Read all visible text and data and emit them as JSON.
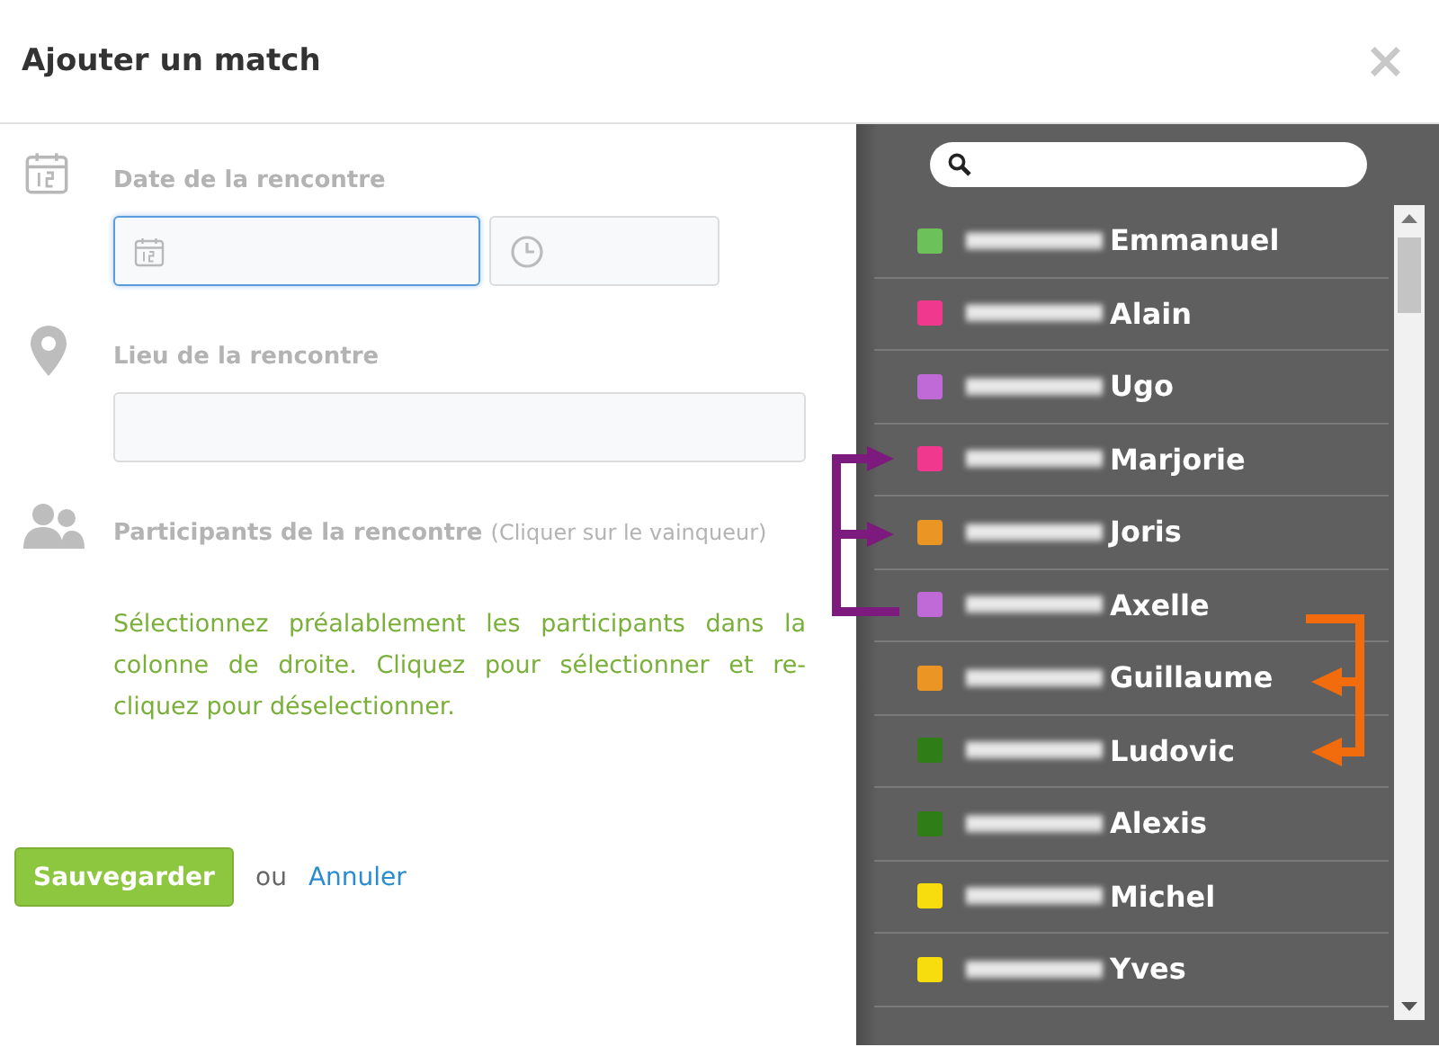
{
  "dialog": {
    "title": "Ajouter un match",
    "close": "×"
  },
  "form": {
    "date_label": "Date de la rencontre",
    "place_label": "Lieu de la rencontre",
    "participants_label": "Participants de la rencontre",
    "participants_hint": "(Cliquer sur le vainqueur)",
    "instructions": "Sélectionnez préalablement les participants dans la colonne de droite. Cliquez pour sélectionner et re-cliquez pour déselectionner.",
    "save": "Sauvegarder",
    "or": "ou",
    "cancel": "Annuler"
  },
  "players": [
    {
      "name": "Emmanuel",
      "color": "#6cc15a"
    },
    {
      "name": "Alain",
      "color": "#f0388f"
    },
    {
      "name": "Ugo",
      "color": "#c06ad8"
    },
    {
      "name": "Marjorie",
      "color": "#f0388f"
    },
    {
      "name": "Joris",
      "color": "#eb9525"
    },
    {
      "name": "Axelle",
      "color": "#c06ad8"
    },
    {
      "name": "Guillaume",
      "color": "#eb9525"
    },
    {
      "name": "Ludovic",
      "color": "#2e7d16"
    },
    {
      "name": "Alexis",
      "color": "#2e7d16"
    },
    {
      "name": "Michel",
      "color": "#f7dc0e"
    },
    {
      "name": "Yves",
      "color": "#f7dc0e"
    }
  ]
}
